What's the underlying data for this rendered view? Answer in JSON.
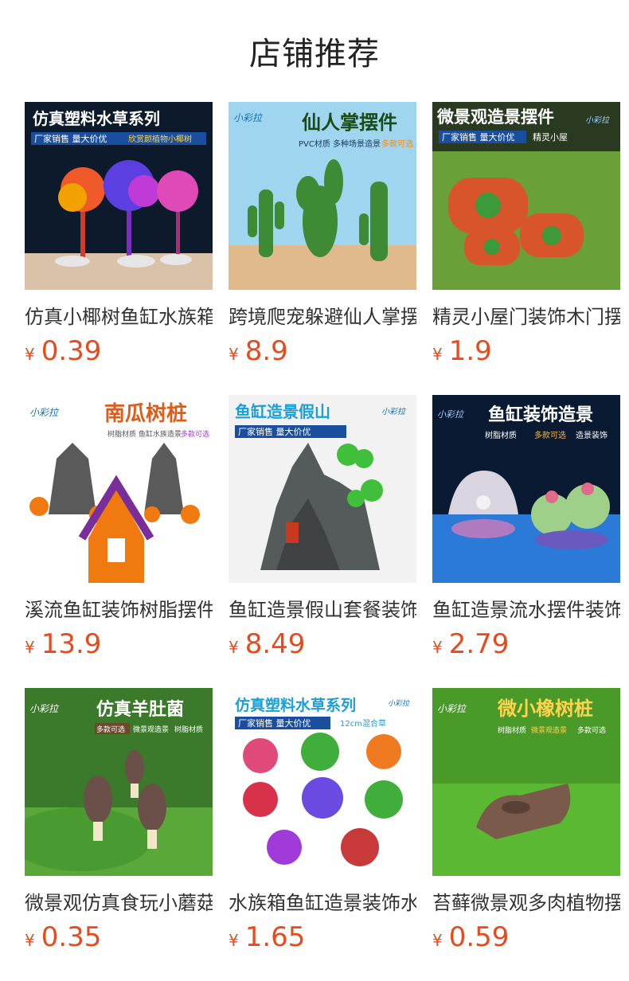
{
  "header": {
    "title": "店铺推荐"
  },
  "products": [
    {
      "name": "仿真小椰树鱼缸水族箱造景装饰",
      "currency": "¥",
      "price": "0.39",
      "banner": {
        "headline": "仿真塑料水草系列",
        "sub1": "厂家销售 量大价优",
        "sub2": "欣赏颜植物小椰树"
      }
    },
    {
      "name": "跨境爬宠躲避仙人掌摆件",
      "currency": "¥",
      "price": "8.9",
      "banner": {
        "headline": "仙人掌摆件",
        "sub1": "PVC材质 多种场景造景",
        "sub2": "多款可选",
        "logo": "小彩拉"
      }
    },
    {
      "name": "精灵小屋门装饰木门摆件",
      "currency": "¥",
      "price": "1.9",
      "banner": {
        "headline": "微景观造景摆件",
        "sub1": "厂家销售 量大价优",
        "sub2": "精灵小屋",
        "logo": "小彩拉"
      }
    },
    {
      "name": "溪流鱼缸装饰树脂摆件",
      "currency": "¥",
      "price": "13.9",
      "banner": {
        "headline": "南瓜树桩",
        "sub1": "树脂材质 鱼缸水族造景",
        "sub2": "多款可选",
        "logo": "小彩拉"
      }
    },
    {
      "name": "鱼缸造景假山套餐装饰",
      "currency": "¥",
      "price": "8.49",
      "banner": {
        "headline": "鱼缸造景假山",
        "sub1": "厂家销售 量大价优",
        "logo": "小彩拉"
      }
    },
    {
      "name": "鱼缸造景流水摆件装饰",
      "currency": "¥",
      "price": "2.79",
      "banner": {
        "headline": "鱼缸装饰造景",
        "sub1": "树脂材质",
        "sub2": "多款可选",
        "sub3": "造景装饰",
        "logo": "小彩拉"
      }
    },
    {
      "name": "微景观仿真食玩小蘑菇",
      "currency": "¥",
      "price": "0.35",
      "banner": {
        "headline": "仿真羊肚菌",
        "sub1": "多款可选",
        "sub2": "微景观造景",
        "sub3": "树脂材质",
        "logo": "小彩拉"
      }
    },
    {
      "name": "水族箱鱼缸造景装饰水草",
      "currency": "¥",
      "price": "1.65",
      "banner": {
        "headline": "仿真塑料水草系列",
        "sub1": "厂家销售 量大价优",
        "sub2": "12cm混合草",
        "logo": "小彩拉"
      }
    },
    {
      "name": "苔藓微景观多肉植物摆件",
      "currency": "¥",
      "price": "0.59",
      "banner": {
        "headline": "微小橡树桩",
        "sub1": "树脂材质",
        "sub2": "微景观造景",
        "sub3": "多款可选",
        "logo": "小彩拉"
      }
    }
  ],
  "colors": {
    "price": "#e8491d",
    "title": "#222222"
  }
}
